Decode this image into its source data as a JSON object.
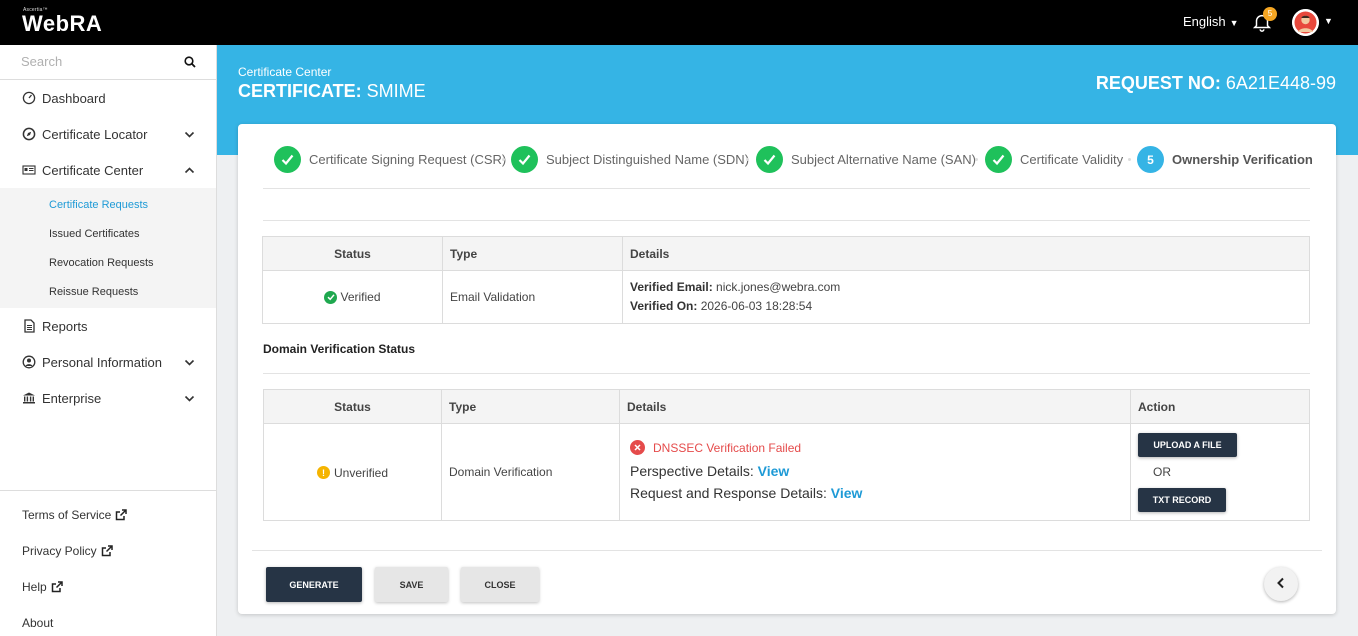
{
  "topbar": {
    "brand_small": "Ascertia™",
    "brand": "WebRA",
    "language": "English",
    "notification_count": "5"
  },
  "sidebar": {
    "search_placeholder": "Search",
    "items": [
      {
        "label": "Dashboard"
      },
      {
        "label": "Certificate Locator"
      },
      {
        "label": "Certificate Center"
      },
      {
        "label": "Reports"
      },
      {
        "label": "Personal Information"
      },
      {
        "label": "Enterprise"
      }
    ],
    "sub_items": [
      {
        "label": "Certificate Requests"
      },
      {
        "label": "Issued Certificates"
      },
      {
        "label": "Revocation Requests"
      },
      {
        "label": "Reissue Requests"
      }
    ],
    "footer": [
      {
        "label": "Terms of Service"
      },
      {
        "label": "Privacy Policy"
      },
      {
        "label": "Help"
      },
      {
        "label": "About"
      }
    ]
  },
  "header": {
    "breadcrumb": "Certificate Center",
    "title_prefix": "CERTIFICATE:",
    "title_value": "SMIME",
    "request_label": "REQUEST NO:",
    "request_value": "6A21E448-99"
  },
  "steps": [
    {
      "label": "Certificate Signing Request (CSR)"
    },
    {
      "label": "Subject Distinguished Name (SDN)"
    },
    {
      "label": "Subject Alternative Name (SAN)"
    },
    {
      "label": "Certificate Validity"
    },
    {
      "number": "5",
      "label": "Ownership Verification"
    }
  ],
  "email_table": {
    "headers": [
      "Status",
      "Type",
      "Details"
    ],
    "row": {
      "status": "Verified",
      "type": "Email Validation",
      "email_label": "Verified Email:",
      "email_value": "nick.jones@webra.com",
      "on_label": "Verified On:",
      "on_value": "2026-06-03 18:28:54"
    }
  },
  "domain_section_title": "Domain Verification Status",
  "domain_table": {
    "headers": [
      "Status",
      "Type",
      "Details",
      "Action"
    ],
    "row": {
      "status": "Unverified",
      "type": "Domain Verification",
      "error": "DNSSEC Verification Failed",
      "perspective_label": "Perspective Details:",
      "perspective_link": "View",
      "reqresp_label": "Request and Response Details:",
      "reqresp_link": "View",
      "upload_btn": "UPLOAD A FILE",
      "or_text": "OR",
      "txt_btn": "TXT RECORD"
    }
  },
  "actions": {
    "generate": "GENERATE",
    "save": "SAVE",
    "close": "CLOSE"
  },
  "colors": {
    "accent": "#35b4e5",
    "success": "#1fc15b",
    "error": "#e54b4b",
    "warning": "#f5b400",
    "dark_button": "#263445"
  }
}
